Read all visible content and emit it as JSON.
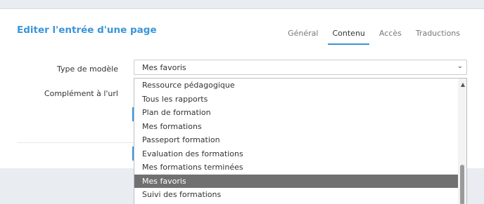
{
  "page": {
    "title": "Editer l'entrée d'une page"
  },
  "tabs": [
    {
      "label": "Général",
      "active": false
    },
    {
      "label": "Contenu",
      "active": true
    },
    {
      "label": "Accès",
      "active": false
    },
    {
      "label": "Traductions",
      "active": false
    }
  ],
  "form": {
    "template_type_label": "Type de modèle",
    "template_type_value": "Mes favoris",
    "url_complement_label": "Complément à l'url"
  },
  "dropdown": {
    "options": [
      "Ressource pédagogique",
      "Tous les rapports",
      "Plan de formation",
      "Mes formations",
      "Passeport formation",
      "Evaluation des formations",
      "Mes formations terminées",
      "Mes favoris",
      "Suivi des formations"
    ],
    "selected": "Mes favoris"
  },
  "icons": {
    "select_chevron": "chevron-down-icon",
    "scroll_up": "scroll-up-arrow-icon"
  },
  "colors": {
    "accent": "#3a95d8",
    "selected_option_bg": "#707070"
  }
}
